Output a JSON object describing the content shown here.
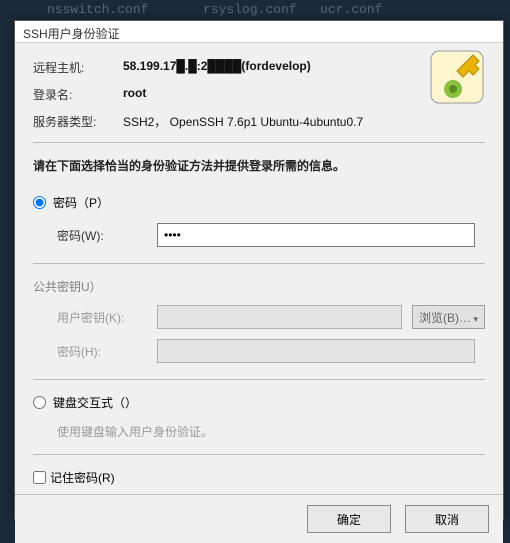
{
  "background_text": "     nsswitch.conf       rsyslog.conf   ucr.conf",
  "dialog": {
    "title": "SSH用户身份验证",
    "info": {
      "host_label": "远程主机:",
      "host_value": "58.199.17█.█:2████(fordevelop)",
      "login_label": "登录名:",
      "login_value": "root",
      "server_label": "服务器类型:",
      "server_value": "SSH2， OpenSSH 7.6p1 Ubuntu-4ubuntu0.7"
    },
    "instruction": "请在下面选择恰当的身份验证方法并提供登录所需的信息。",
    "pw_section": {
      "radio_label": "密码（P）",
      "field_label": "密码(W):",
      "value": "••••"
    },
    "pk_section": {
      "title": "公共密钥U）",
      "key_label": "用户密钥(K):",
      "browse": "浏览(B)…",
      "pass_label": "密码(H):"
    },
    "ki_section": {
      "radio_label": "键盘交互式（）",
      "hint": "使用键盘输入用户身份验证。"
    },
    "remember_label": "记住密码(R)",
    "buttons": {
      "ok": "确定",
      "cancel": "取消"
    }
  }
}
